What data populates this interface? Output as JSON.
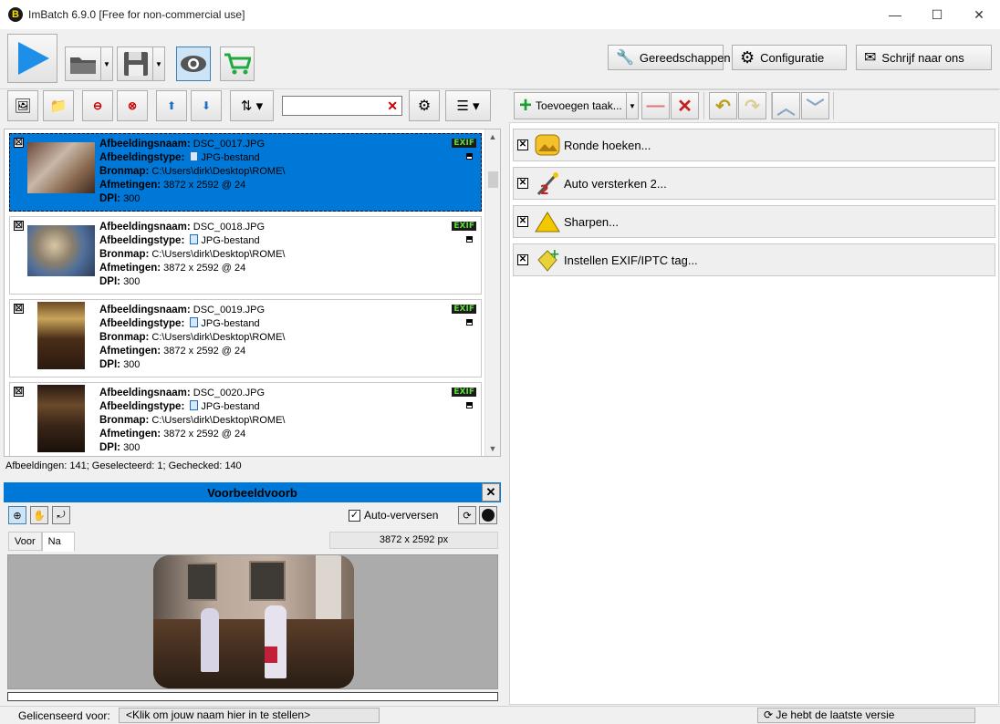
{
  "window": {
    "title": "ImBatch 6.9.0 [Free for non-commercial use]",
    "logo_letter": "B",
    "minimize": "—",
    "maximize": "☐",
    "close": "✕"
  },
  "toolbar": {
    "tools_label": "Gereedschappen",
    "config_label": "Configuratie",
    "contact_label": "Schrijf naar ons"
  },
  "left": {
    "search_value": "",
    "status": "Afbeeldingen: 141; Geselecteerd: 1; Gechecked: 140",
    "field_labels": {
      "name": "Afbeeldingsnaam:",
      "type": "Afbeeldingstype:",
      "folder": "Bronmap:",
      "size": "Afmetingen:",
      "dpi": "DPI:"
    },
    "exif_badge": "EXIF",
    "images": [
      {
        "name": "DSC_0017.JPG",
        "type": "JPG-bestand",
        "folder": "C:\\Users\\dirk\\Desktop\\ROME\\",
        "size": "3872 x 2592 @ 24",
        "dpi": "300",
        "checked": "☒",
        "selected": true
      },
      {
        "name": "DSC_0018.JPG",
        "type": "JPG-bestand",
        "folder": "C:\\Users\\dirk\\Desktop\\ROME\\",
        "size": "3872 x 2592 @ 24",
        "dpi": "300",
        "checked": "☒",
        "selected": false
      },
      {
        "name": "DSC_0019.JPG",
        "type": "JPG-bestand",
        "folder": "C:\\Users\\dirk\\Desktop\\ROME\\",
        "size": "3872 x 2592 @ 24",
        "dpi": "300",
        "checked": "☒",
        "selected": false
      },
      {
        "name": "DSC_0020.JPG",
        "type": "JPG-bestand",
        "folder": "C:\\Users\\dirk\\Desktop\\ROME\\",
        "size": "3872 x 2592 @ 24",
        "dpi": "300",
        "checked": "☒",
        "selected": false
      }
    ]
  },
  "preview": {
    "title": "Voorbeeldvoorb",
    "close": "✕",
    "auto_refresh_label": "Auto-verversen",
    "auto_refresh_checked": "✓",
    "tab_before": "Voor",
    "tab_after": "Na",
    "dimensions": "3872 x 2592 px"
  },
  "tasks": {
    "add_label": "Toevoegen taak...",
    "items": [
      {
        "label": "Ronde hoeken...",
        "checked": "✕"
      },
      {
        "label": "Auto versterken 2...",
        "checked": "✕"
      },
      {
        "label": "Sharpen...",
        "checked": "✕"
      },
      {
        "label": "Instellen EXIF/IPTC tag...",
        "checked": "✕"
      }
    ]
  },
  "footer": {
    "licensed_label": "Gelicenseerd voor:",
    "licensed_value": "<Klik om jouw naam hier in te stellen>",
    "version_status": "Je hebt de laatste versie"
  },
  "colors": {
    "selection": "#0078d7",
    "play": "#1e8fe8",
    "cart": "#1eaa3c",
    "exif_text": "#5cdc3c"
  }
}
